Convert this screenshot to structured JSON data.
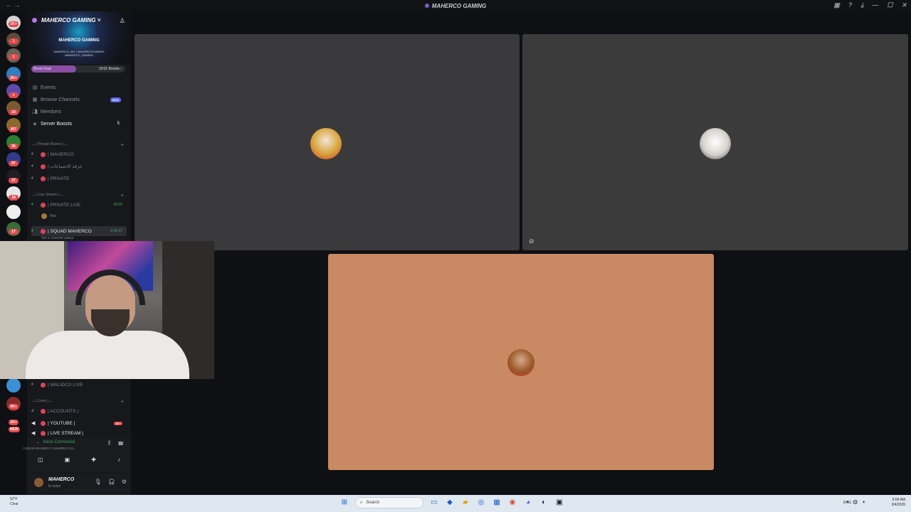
{
  "window": {
    "title": "MAHERCO GAMING",
    "controls": [
      "—",
      "☐",
      "✕"
    ]
  },
  "rail_badges": [
    "1K+",
    "1",
    "1",
    "2K+",
    "1",
    "10",
    "807",
    "95",
    "97",
    "37",
    "18",
    "17",
    "9K+",
    "1K+",
    "NEW"
  ],
  "server": {
    "name": "MAHERCO GAMING",
    "logo_text": "MAHERCO GAMING",
    "handles_line1": "/MAHERCO_MG | /MAHERCOGAMING",
    "handles_line2": "/MAHERCO_GAMING",
    "boost_label": "Boost Goal",
    "boost_count": "15/31 Boosts",
    "boost_progress": 0.48
  },
  "menu": {
    "events": "Events",
    "browse": "Browse Channels",
    "browse_badge": "NEW",
    "members": "Members",
    "boosts": "Server Boosts",
    "boosts_count": "5"
  },
  "channels": {
    "cat_private": "ــ ( Private Rooms ) ــ",
    "ch_maherco": "| MAHERCO",
    "ch_arabic": "| غرفة الاجتماعات",
    "ch_private": "| PRIVATE",
    "cat_live": "ــ ( Live Stream ) ــ",
    "ch_private_live": "| PRIVATE LIVE",
    "ch_private_live_time": "58:25",
    "sub_hex": "Hex",
    "ch_squad": "| SQUAD MAHERCO",
    "ch_squad_time": "8:46:37",
    "sub_status": "Set a channel status",
    "ch_walidco": "| WALIDCO LIVE",
    "cat_lives": "ــ ( Lives ) ــ",
    "ch_accounts": "| ACCOUNTS |",
    "ch_youtube": "| YOUTUBE |",
    "ch_youtube_badge": "1K+",
    "ch_livestream": "| LIVE STREAM |"
  },
  "voice": {
    "status": "Voice Connected",
    "location": "| SQUAD MAHERCO / MAHERCO GA..."
  },
  "user": {
    "name": "MAHERCO",
    "status": "In voice"
  },
  "taskbar": {
    "temp": "52°F",
    "weather": "Clear",
    "search": "Search",
    "lang": "ENG",
    "time": "5:09 AM",
    "date": "3/4/2026"
  },
  "colors": {
    "tile_orange": "#c98963",
    "tile_grey": "#3a3a3c",
    "voice_green": "#3aa55d",
    "boost_purple": "#8a4fa3",
    "blurple": "#5865f2"
  }
}
